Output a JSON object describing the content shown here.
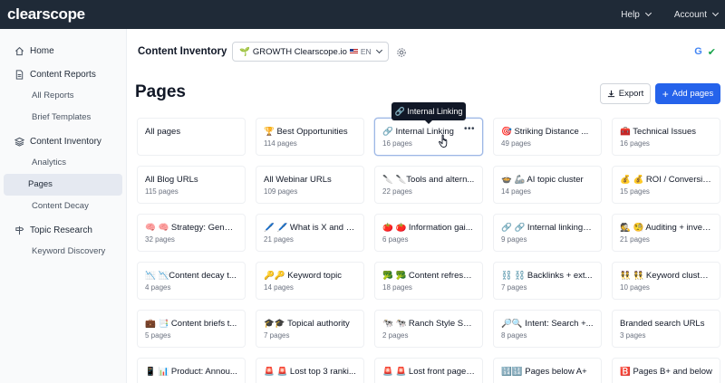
{
  "topbar": {
    "logo": "clearscope",
    "nav": [
      {
        "label": "Help"
      },
      {
        "label": "Account"
      }
    ]
  },
  "sidebar": {
    "home": "Home",
    "content_reports": "Content Reports",
    "all_reports": "All Reports",
    "brief_templates": "Brief Templates",
    "content_inventory": "Content Inventory",
    "analytics": "Analytics",
    "pages": "Pages",
    "content_decay": "Content Decay",
    "topic_research": "Topic Research",
    "keyword_discovery": "Keyword Discovery"
  },
  "header": {
    "title": "Content Inventory",
    "site": "🌱 GROWTH Clearscope.io",
    "lang": "EN"
  },
  "page": {
    "title": "Pages",
    "export_label": "Export",
    "add_label": "Add pages"
  },
  "tooltip": {
    "text": "🔗 Internal Linking"
  },
  "cards": [
    {
      "name": "All pages",
      "count": ""
    },
    {
      "name": "🏆 Best Opportunities",
      "count": "114 pages"
    },
    {
      "name": "🔗 Internal Linking",
      "count": "16 pages"
    },
    {
      "name": "🎯 Striking Distance ...",
      "count": "49 pages"
    },
    {
      "name": "🧰 Technical Issues",
      "count": "16 pages"
    },
    {
      "name": "All Blog URLs",
      "count": "115 pages"
    },
    {
      "name": "All Webinar URLs",
      "count": "109 pages"
    },
    {
      "name": "🔪 🔪Tools and altern...",
      "count": "22 pages"
    },
    {
      "name": "🍲 🦾 AI topic cluster",
      "count": "14 pages"
    },
    {
      "name": "💰 💰 ROI / Conversio...",
      "count": "15 pages"
    },
    {
      "name": "🧠 🧠 Strategy: Gener...",
      "count": "32 pages"
    },
    {
      "name": "🖊️ 🖊️ What is X and w...",
      "count": "21 pages"
    },
    {
      "name": "🍅 🍅 Information gai...",
      "count": "6 pages"
    },
    {
      "name": "🔗 🔗 Internal linking t...",
      "count": "9 pages"
    },
    {
      "name": "🕵️ 🧐 Auditing + inven...",
      "count": "21 pages"
    },
    {
      "name": "📉 📉Content decay t...",
      "count": "4 pages"
    },
    {
      "name": "🔑🔑 Keyword topic",
      "count": "14 pages"
    },
    {
      "name": "🥦 🥦 Content refresh...",
      "count": "18 pages"
    },
    {
      "name": "⛓️ ⛓️ Backlinks + ext...",
      "count": "7 pages"
    },
    {
      "name": "👯 👯 Keyword cluster...",
      "count": "10 pages"
    },
    {
      "name": "💼 📑 Content briefs t...",
      "count": "5 pages"
    },
    {
      "name": "🎓🎓 Topical authority",
      "count": "7 pages"
    },
    {
      "name": "🐄 🐄 Ranch Style SE...",
      "count": "2 pages"
    },
    {
      "name": "🔎🔍 Intent: Search +...",
      "count": "8 pages"
    },
    {
      "name": "Branded search URLs",
      "count": "3 pages"
    },
    {
      "name": "📱 📊 Product: Annou...",
      "count": ""
    },
    {
      "name": "🚨 🚨 Lost top 3 ranki...",
      "count": ""
    },
    {
      "name": "🚨 🚨 Lost front page r...",
      "count": ""
    },
    {
      "name": "🔢🔢 Pages below A+",
      "count": ""
    },
    {
      "name": "🅱️ Pages B+ and below",
      "count": ""
    }
  ]
}
